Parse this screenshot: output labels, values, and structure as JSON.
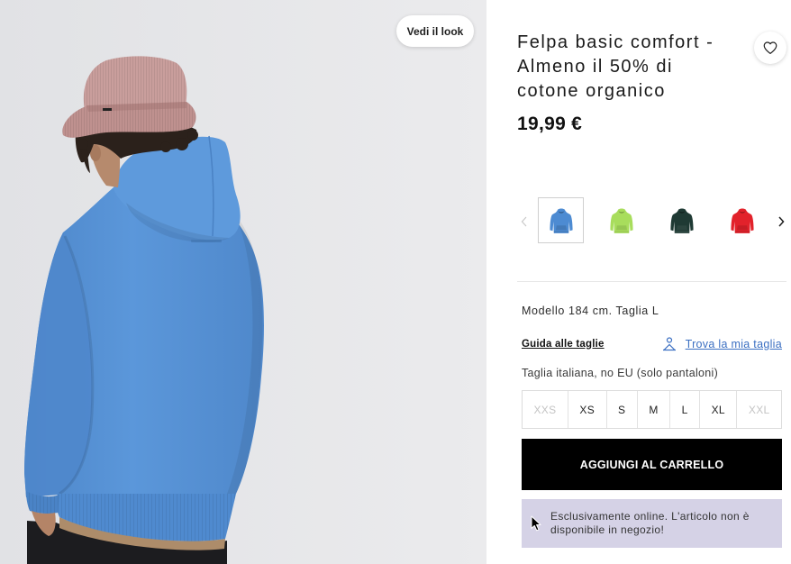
{
  "look_button": {
    "label": "Vedi il look"
  },
  "product": {
    "title": "Felpa basic comfort - Almeno il 50% di cotone organico",
    "price": "19,99 €",
    "wishlist_icon": "heart-icon"
  },
  "color_selector": {
    "prev_icon": "chevron-left-icon",
    "next_icon": "chevron-right-icon",
    "prev_disabled": true,
    "options": [
      {
        "hex": "#4d8bd2",
        "selected": true
      },
      {
        "hex": "#a8dd5c",
        "selected": false
      },
      {
        "hex": "#1f3a34",
        "selected": false
      },
      {
        "hex": "#e2222b",
        "selected": false
      }
    ]
  },
  "model_info": "Modello 184 cm. Taglia L",
  "size_guide": {
    "guide_link": "Guida alle taglie",
    "find_size_link": "Trova la mia taglia",
    "find_size_icon": "person-measure-icon",
    "note": "Taglia italiana, no EU (solo pantaloni)"
  },
  "sizes": [
    {
      "label": "XXS",
      "available": false
    },
    {
      "label": "XS",
      "available": true
    },
    {
      "label": "S",
      "available": true
    },
    {
      "label": "M",
      "available": true
    },
    {
      "label": "L",
      "available": true
    },
    {
      "label": "XL",
      "available": true
    },
    {
      "label": "XXL",
      "available": false
    }
  ],
  "add_to_cart": {
    "label": "AGGIUNGI AL CARRELLO"
  },
  "notice": {
    "text": "Esclusivamente online. L'articolo non è disponibile in negozio!",
    "background": "#d5d2e6"
  },
  "theme": {
    "link_color": "#3b6fc2",
    "button_color": "#000000"
  }
}
